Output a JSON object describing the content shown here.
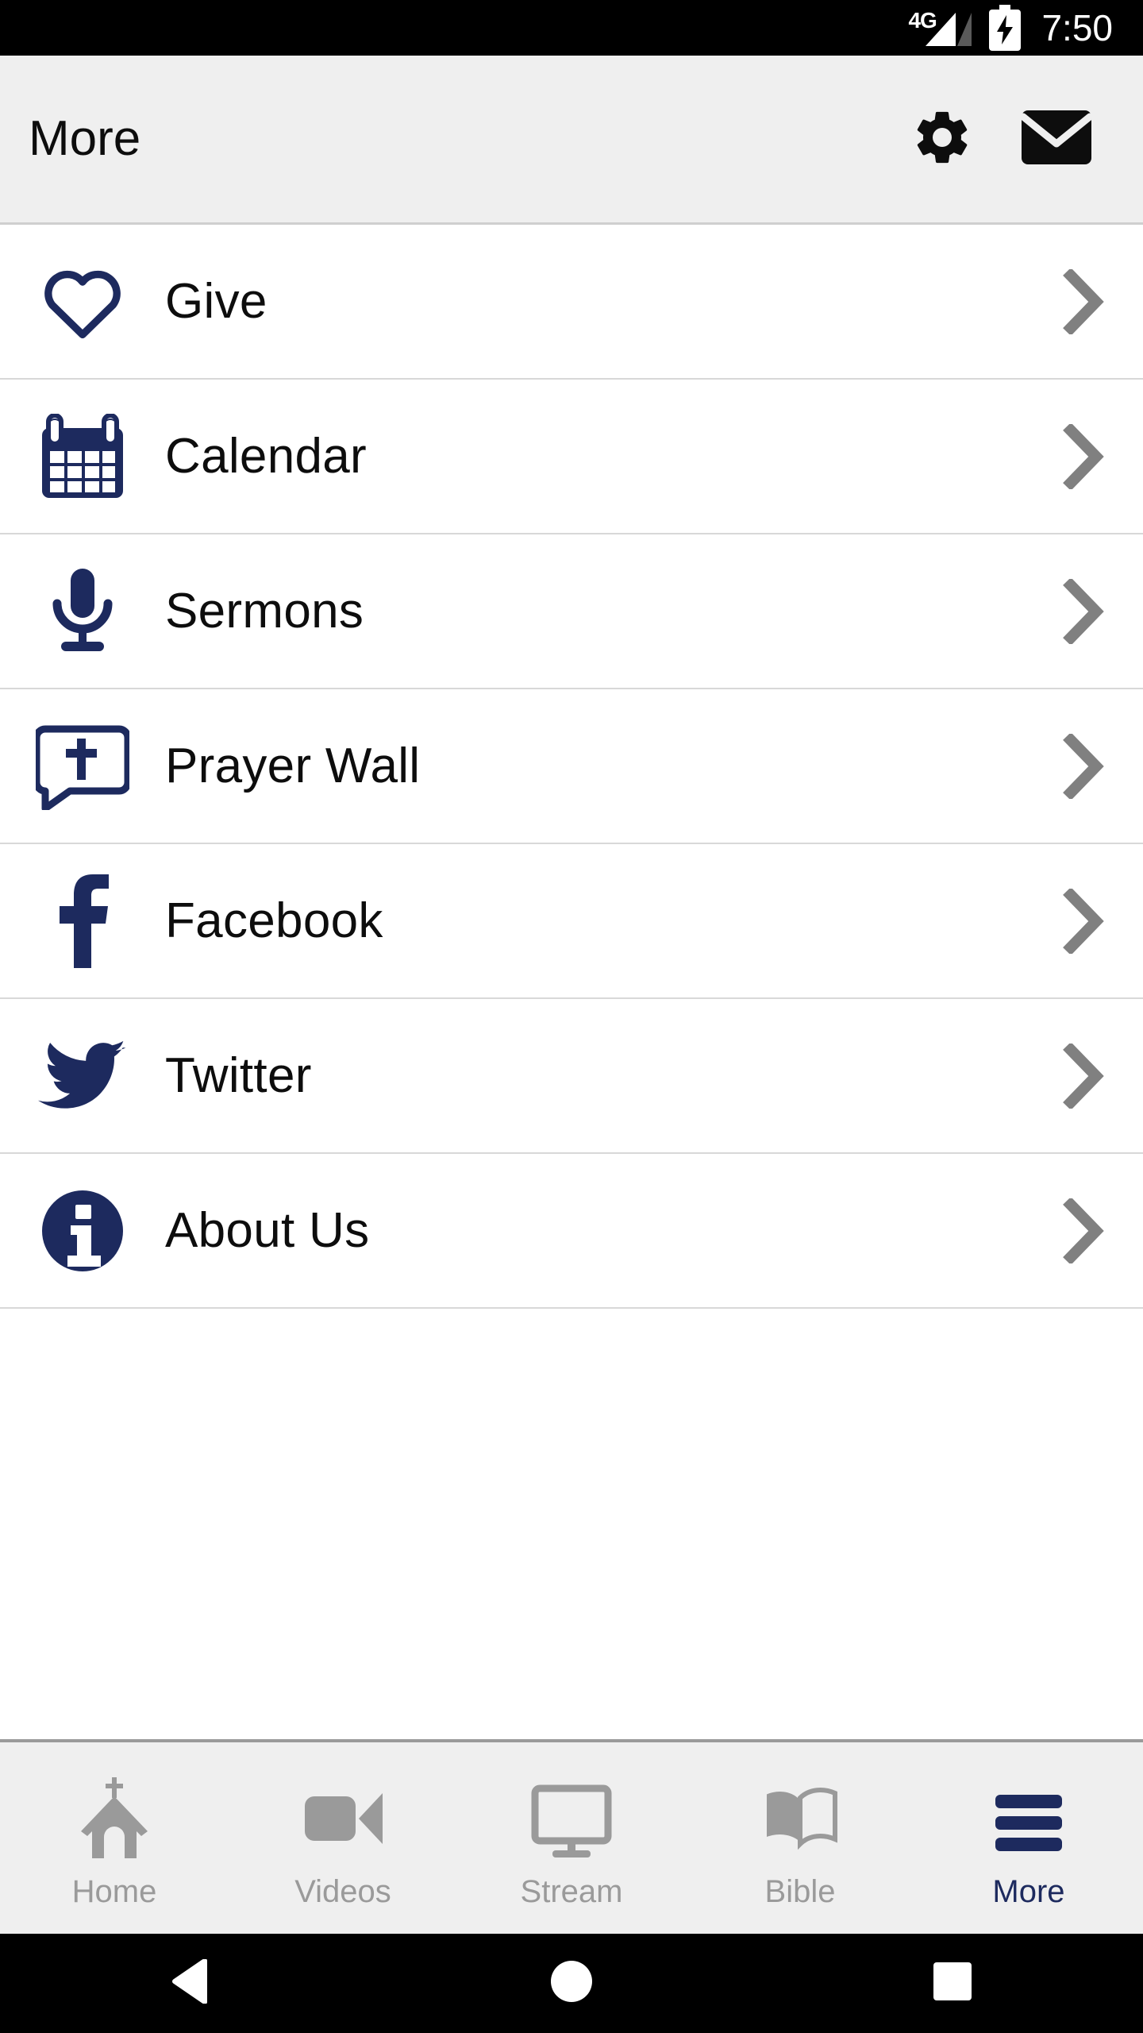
{
  "status_bar": {
    "network_label": "4G",
    "time": "7:50",
    "battery_icon": "battery-charging-icon",
    "signal_icon": "signal-bars-icon"
  },
  "header": {
    "title": "More",
    "settings_icon": "gear-icon",
    "mail_icon": "envelope-icon"
  },
  "colors": {
    "brand_navy": "#1d2a5e",
    "header_bg": "#efefef",
    "divider": "#d8d8d8",
    "chevron": "#808080",
    "tab_inactive": "#9a9a9a",
    "status_bg": "#000000"
  },
  "list": {
    "items": [
      {
        "label": "Give",
        "icon": "heart-outline-icon",
        "chevron": "chevron-right-icon"
      },
      {
        "label": "Calendar",
        "icon": "calendar-icon",
        "chevron": "chevron-right-icon"
      },
      {
        "label": "Sermons",
        "icon": "microphone-icon",
        "chevron": "chevron-right-icon"
      },
      {
        "label": "Prayer Wall",
        "icon": "speech-bubble-cross-icon",
        "chevron": "chevron-right-icon"
      },
      {
        "label": "Facebook",
        "icon": "facebook-icon",
        "chevron": "chevron-right-icon"
      },
      {
        "label": "Twitter",
        "icon": "twitter-bird-icon",
        "chevron": "chevron-right-icon"
      },
      {
        "label": "About Us",
        "icon": "info-circle-icon",
        "chevron": "chevron-right-icon"
      }
    ]
  },
  "tab_bar": {
    "tabs": [
      {
        "label": "Home",
        "icon": "church-icon",
        "active": false
      },
      {
        "label": "Videos",
        "icon": "video-camera-icon",
        "active": false
      },
      {
        "label": "Stream",
        "icon": "monitor-icon",
        "active": false
      },
      {
        "label": "Bible",
        "icon": "open-book-icon",
        "active": false
      },
      {
        "label": "More",
        "icon": "hamburger-icon",
        "active": true
      }
    ]
  },
  "android_nav": {
    "back": "back-triangle-icon",
    "home": "home-circle-icon",
    "recents": "recents-square-icon"
  }
}
